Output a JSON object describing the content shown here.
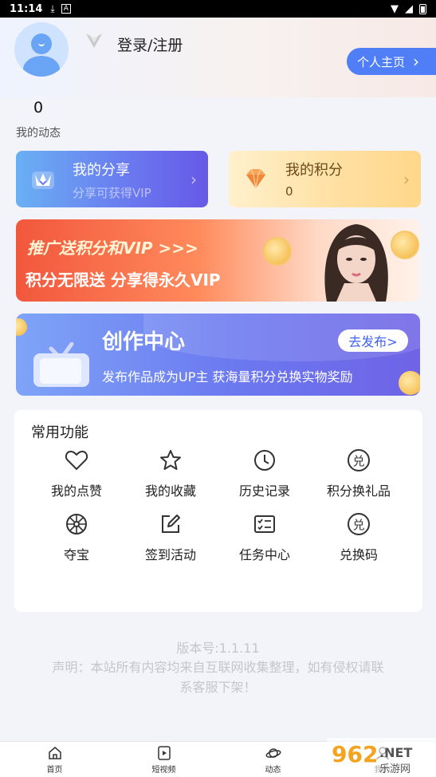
{
  "status_bar": {
    "time": "11:14"
  },
  "profile": {
    "login_label": "登录/注册",
    "home_button": "个人主页",
    "posts_count": "0",
    "posts_label": "我的动态"
  },
  "cards": {
    "share": {
      "title": "我的分享",
      "subtitle": "分享可获得VIP"
    },
    "points": {
      "title": "我的积分",
      "value": "0"
    }
  },
  "banner_promo": {
    "line1": "推广送积分和VIP >>>",
    "line2": "积分无限送 分享得永久VIP"
  },
  "banner_creator": {
    "title": "创作中心",
    "subtitle": "发布作品成为UP主 获海量积分兑换实物奖励",
    "button": "去发布>"
  },
  "functions": {
    "title": "常用功能",
    "items": [
      {
        "label": "我的点赞",
        "icon": "heart-icon"
      },
      {
        "label": "我的收藏",
        "icon": "star-icon"
      },
      {
        "label": "历史记录",
        "icon": "clock-icon"
      },
      {
        "label": "积分换礼品",
        "icon": "redeem-icon"
      },
      {
        "label": "夺宝",
        "icon": "wheel-icon"
      },
      {
        "label": "签到活动",
        "icon": "edit-icon"
      },
      {
        "label": "任务中心",
        "icon": "task-list-icon"
      },
      {
        "label": "兑换码",
        "icon": "redeem-icon"
      }
    ]
  },
  "footer": {
    "version": "版本号:1.1.11",
    "notice": "声明：本站所有内容均来自互联网收集整理，如有侵权请联系客服下架！"
  },
  "tabs": [
    {
      "label": "首页",
      "icon": "home-icon"
    },
    {
      "label": "短视频",
      "icon": "play-icon"
    },
    {
      "label": "动态",
      "icon": "planet-icon"
    },
    {
      "label": "我的",
      "icon": "user-icon"
    }
  ],
  "watermark": {
    "text": "962",
    "suffix": ".NET",
    "sub": "乐游网"
  },
  "colors": {
    "accent": "#4f7ef6",
    "promo": "#f2573c",
    "creator": "#6b78f0"
  }
}
